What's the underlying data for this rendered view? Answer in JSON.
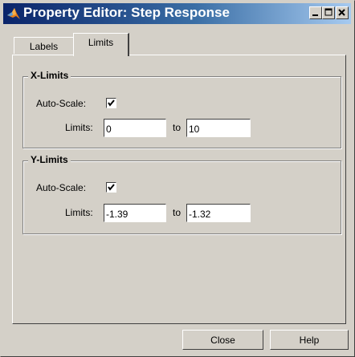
{
  "window": {
    "title": "Property Editor: Step Response"
  },
  "tabs": [
    {
      "label": "Labels",
      "active": false
    },
    {
      "label": "Limits",
      "active": true
    }
  ],
  "x_limits": {
    "title": "X-Limits",
    "autoscale_label": "Auto-Scale:",
    "autoscale_checked": true,
    "limits_label": "Limits:",
    "min": "0",
    "to_label": "to",
    "max": "10"
  },
  "y_limits": {
    "title": "Y-Limits",
    "autoscale_label": "Auto-Scale:",
    "autoscale_checked": true,
    "limits_label": "Limits:",
    "min": "-1.39",
    "to_label": "to",
    "max": "-1.32"
  },
  "buttons": {
    "close": "Close",
    "help": "Help"
  },
  "colors": {
    "titlebar_start": "#0a246a",
    "titlebar_end": "#a6caf0",
    "face": "#d4d0c8"
  },
  "icons": {
    "title": "matlab-logo-icon",
    "minimize": "minimize-icon",
    "maximize": "maximize-icon",
    "close": "close-icon",
    "check": "checkmark-icon"
  }
}
